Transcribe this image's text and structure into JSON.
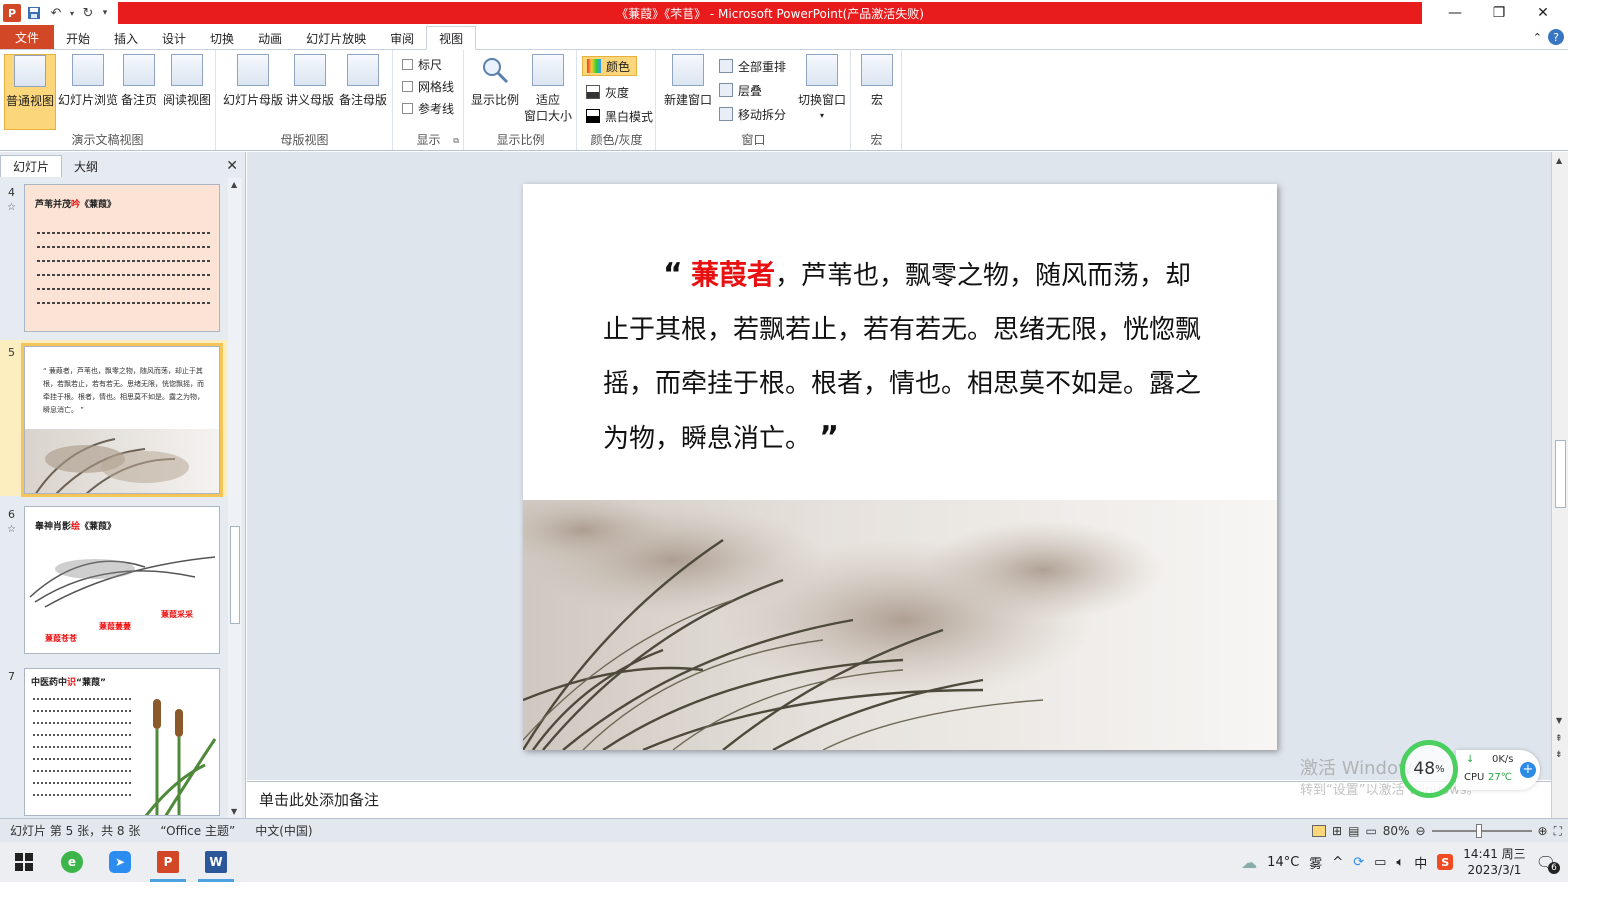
{
  "window": {
    "title": "《蒹葭》《芣苢》 - Microsoft PowerPoint(产品激活失败)"
  },
  "ribbon_tabs": [
    "开始",
    "插入",
    "设计",
    "切换",
    "动画",
    "幻灯片放映",
    "审阅",
    "视图"
  ],
  "file_tab": "文件",
  "active_tab": "视图",
  "groups": {
    "presentation_views": {
      "title": "演示文稿视图",
      "buttons": [
        "普通视图",
        "幻灯片浏览",
        "备注页",
        "阅读视图"
      ]
    },
    "master_views": {
      "title": "母版视图",
      "buttons": [
        "幻灯片母版",
        "讲义母版",
        "备注母版"
      ]
    },
    "show": {
      "title": "显示",
      "checks": [
        "标尺",
        "网格线",
        "参考线"
      ]
    },
    "zoom": {
      "title": "显示比例",
      "buttons": [
        "显示比例",
        "适应",
        "窗口大小"
      ]
    },
    "color": {
      "title": "颜色/灰度",
      "items": [
        "颜色",
        "灰度",
        "黑白模式"
      ]
    },
    "window": {
      "title": "窗口",
      "new_window": "新建窗口",
      "items": [
        "全部重排",
        "层叠",
        "移动拆分"
      ],
      "switch": "切换窗口"
    },
    "macro": {
      "title": "宏",
      "button": "宏"
    }
  },
  "left_panel": {
    "tabs": [
      "幻灯片",
      "大纲"
    ],
    "slides": [
      {
        "num": "4",
        "title_a": "芦苇并茂",
        "title_b": "吟",
        "title_c": "《蒹葭》"
      },
      {
        "num": "5",
        "text": "“ 蒹葭者，芦苇也，飘零之物，随风而荡，却止于其根，若飘若止，若有若无。思绪无限，恍惚飘摇，而牵挂于根。根者，情也。相思莫不如是。露之为物，瞬息消亡。 ”"
      },
      {
        "num": "6",
        "title_a": "睾神肖影",
        "title_b": "绘",
        "title_c": "《蒹葭》",
        "labels": [
          "蒹葭采采",
          "蒹葭萋萋",
          "蒹葭苍苍"
        ]
      },
      {
        "num": "7",
        "title_a": "中医药中",
        "title_b": "识",
        "title_c": "“蒹葭”"
      }
    ]
  },
  "slide": {
    "quote_open": "“",
    "highlight": "蒹葭者",
    "body": "，芦苇也，飘零之物，随风而荡，却止于其根，若飘若止，若有若无。思绪无限，恍惚飘摇，而牵挂于根。根者，情也。相思莫不如是。露之为物，瞬息消亡。",
    "quote_close": "”"
  },
  "notes": {
    "placeholder": "单击此处添加备注"
  },
  "status": {
    "slide_info": "幻灯片 第 5 张，共 8 张",
    "theme": "“Office 主题”",
    "language": "中文(中国)",
    "zoom": "80%"
  },
  "widget": {
    "percent": "48",
    "percent_sign": "%",
    "net": "0K/s",
    "cpu_label": "CPU",
    "cpu_temp": "27℃"
  },
  "activate": {
    "line1": "激活 Windows",
    "line2": "转到“设置”以激活 Windows。"
  },
  "taskbar": {
    "weather_temp": "14°C",
    "weather_desc": "雾",
    "ime": "中",
    "time": "14:41",
    "weekday": "周三",
    "date": "2023/3/1",
    "notif_count": "6"
  },
  "colors": {
    "title_bar": "#e81c1c",
    "file_tab": "#d24726",
    "selected_view": "#fcd67a",
    "highlight_text": "#e81010"
  }
}
